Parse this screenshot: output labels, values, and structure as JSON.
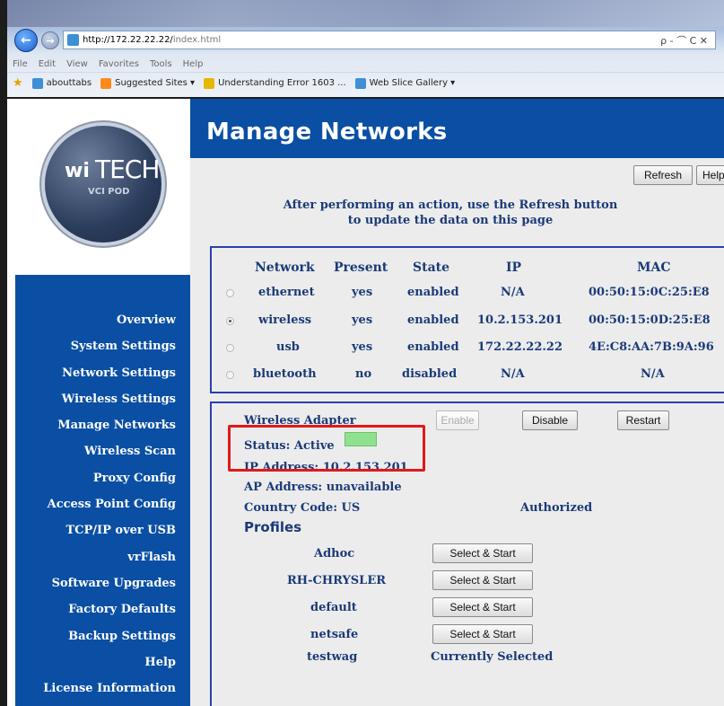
{
  "browser": {
    "url_host": "http://172.22.22.22/",
    "url_path": "index.html",
    "addr_tools": "ρ - ⌒ C ✕",
    "menu": [
      "File",
      "Edit",
      "View",
      "Favorites",
      "Tools",
      "Help"
    ],
    "favorites": [
      {
        "label": "abouttabs",
        "color": "#3e8fd6"
      },
      {
        "label": "Suggested Sites ▾",
        "color": "#ff8a1a"
      },
      {
        "label": "Understanding Error 1603 ...",
        "color": "#e6b800"
      },
      {
        "label": "Web Slice Gallery ▾",
        "color": "#3e8fd6"
      }
    ]
  },
  "logo": {
    "wi": "wi",
    "tech": "TECH",
    "sub": "VCI POD"
  },
  "nav": [
    "Overview",
    "System Settings",
    "Network Settings",
    "Wireless Settings",
    "Manage Networks",
    "Wireless Scan",
    "Proxy Config",
    "Access Point Config",
    "TCP/IP over USB",
    "vrFlash",
    "Software Upgrades",
    "Factory Defaults",
    "Backup Settings",
    "Help",
    "License Information"
  ],
  "page": {
    "title": "Manage Networks",
    "refresh_label": "Refresh",
    "help_label": "Help",
    "hint_line1": "After performing an action, use the Refresh button",
    "hint_line2": "to update the data on this page"
  },
  "networks": {
    "headers": {
      "network": "Network",
      "present": "Present",
      "state": "State",
      "ip": "IP",
      "mac": "MAC"
    },
    "rows": [
      {
        "network": "ethernet",
        "present": "yes",
        "state": "enabled",
        "ip": "N/A",
        "mac": "00:50:15:0C:25:E8",
        "selected": false
      },
      {
        "network": "wireless",
        "present": "yes",
        "state": "enabled",
        "ip": "10.2.153.201",
        "mac": "00:50:15:0D:25:E8",
        "selected": true
      },
      {
        "network": "usb",
        "present": "yes",
        "state": "enabled",
        "ip": "172.22.22.22",
        "mac": "4E:C8:AA:7B:9A:96",
        "selected": false
      },
      {
        "network": "bluetooth",
        "present": "no",
        "state": "disabled",
        "ip": "N/A",
        "mac": "N/A",
        "selected": false
      }
    ]
  },
  "adapter": {
    "title": "Wireless Adapter",
    "enable_label": "Enable",
    "disable_label": "Disable",
    "restart_label": "Restart",
    "status": "Status: Active",
    "status_color": "#8fe08f",
    "ip": "IP Address: 10.2.153.201",
    "ap": "AP Address: unavailable",
    "country": "Country Code: US",
    "authorized": "Authorized",
    "profiles_heading": "Profiles",
    "profiles": [
      {
        "name": "Adhoc",
        "action": "Select & Start"
      },
      {
        "name": "RH-CHRYSLER",
        "action": "Select & Start"
      },
      {
        "name": "default",
        "action": "Select & Start"
      },
      {
        "name": "netsafe",
        "action": "Select & Start"
      },
      {
        "name": "testwag",
        "action": "Currently Selected"
      }
    ]
  },
  "highlight_color": "#e0191b"
}
